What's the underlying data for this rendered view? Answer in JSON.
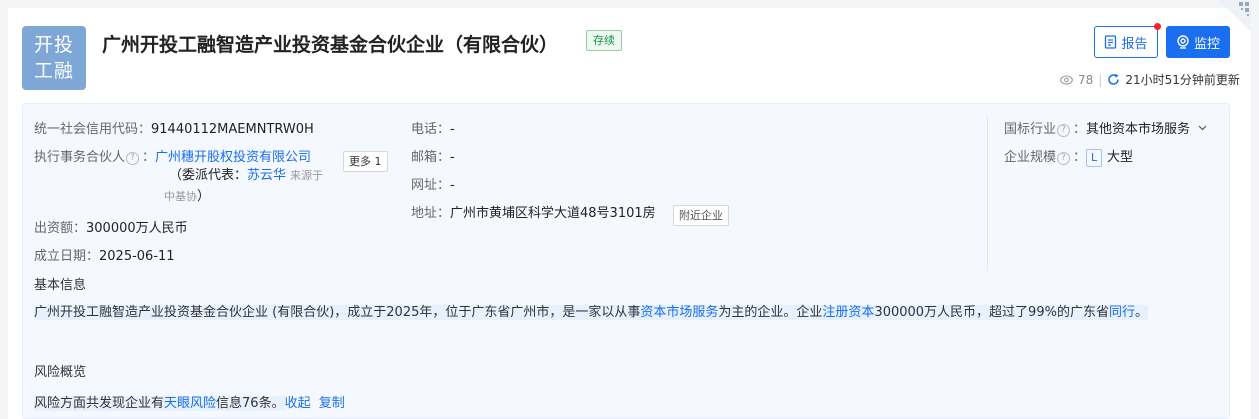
{
  "company": {
    "logo_line1": "开投",
    "logo_line2": "工融",
    "name": "广州开投工融智造产业投资基金合伙企业（有限合伙）",
    "status": "存续"
  },
  "actions": {
    "report_label": "报告",
    "monitor_label": "监控"
  },
  "meta": {
    "views": "78",
    "updated": "21小时51分钟前更新"
  },
  "info": {
    "credit_code_label": "统一社会信用代码：",
    "credit_code_value": "91440112MAEMNTRW0H",
    "partner_label": "执行事务合伙人",
    "partner_value": "广州穗开股权投资有限公司",
    "more_label": "更多 1",
    "rep_prefix": "（委派代表：",
    "rep_name": "苏云华",
    "rep_source": "来源于",
    "rep_source2": "中基协",
    "rep_suffix": "）",
    "capital_label": "出资额：",
    "capital_value": "300000万人民币",
    "date_label": "成立日期：",
    "date_value": "2025-06-11",
    "phone_label": "电话：",
    "phone_value": "-",
    "email_label": "邮箱：",
    "email_value": "-",
    "website_label": "网址：",
    "website_value": "-",
    "address_label": "地址：",
    "address_value": "广州市黄埔区科学大道48号3101房",
    "nearby_label": "附近企业",
    "industry_label": "国标行业",
    "industry_value": "其他资本市场服务",
    "scale_label": "企业规模",
    "scale_badge": "L",
    "scale_value": "大型"
  },
  "basic": {
    "title": "基本信息",
    "p1": "广州开投工融智造产业投资基金合伙企业 (有限合伙)，成立于2025年，位于广东省广州市，是一家以从事",
    "p1_link": "资本市场服务",
    "p2": "为主的企业。企业",
    "p2_link": "注册资本",
    "p3": "300000万人民币，超过了99%的广东省",
    "p3_link": "同行",
    "p4": "。"
  },
  "risk": {
    "title": "风险概览",
    "text1": "风险方面共发现企业有",
    "link": "天眼风险",
    "text2": "信息76条。",
    "collapse_label": "收起",
    "copy_label": "复制"
  }
}
